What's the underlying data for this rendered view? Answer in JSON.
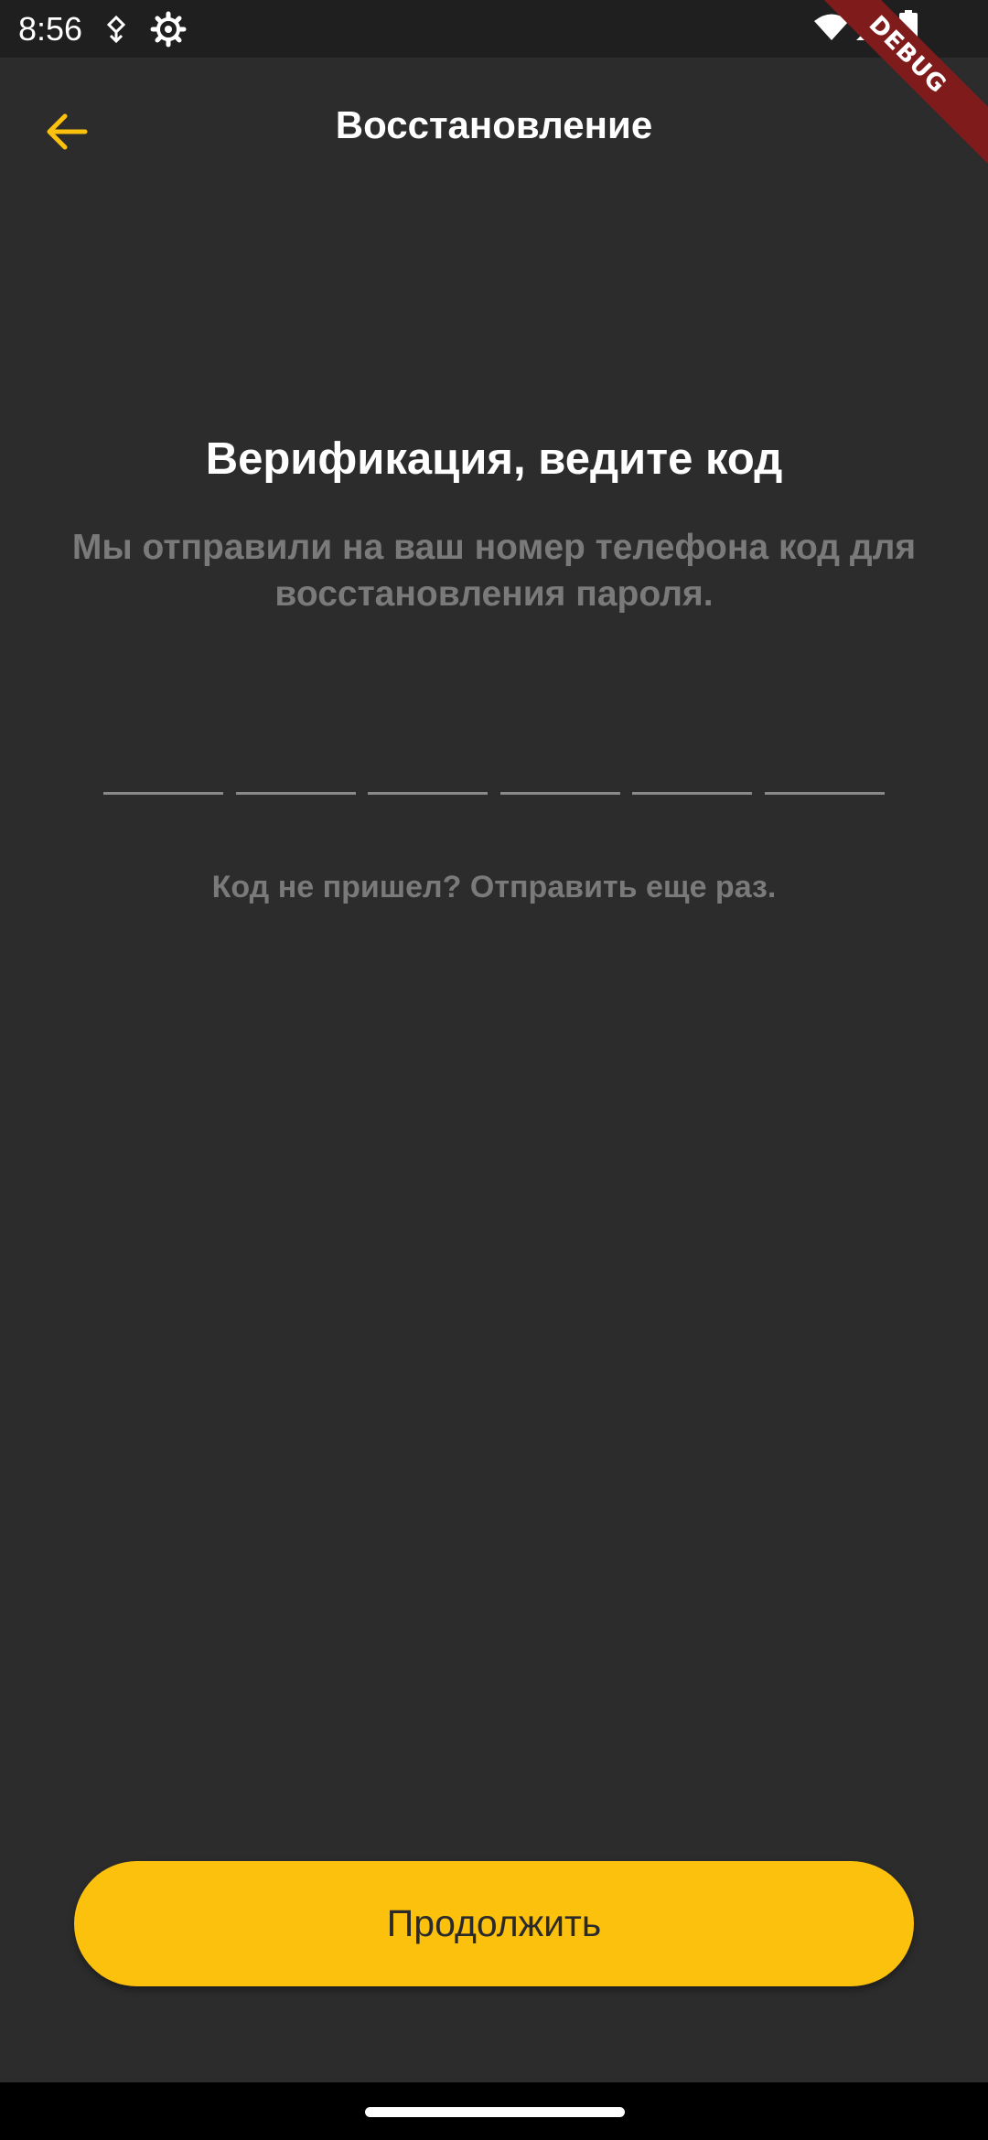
{
  "status_bar": {
    "time": "8:56",
    "icons": [
      "data-saver-icon",
      "settings-gear-icon",
      "wifi-icon",
      "cellular-signal-icon",
      "battery-icon"
    ]
  },
  "debug_banner": "DEBUG",
  "app_bar": {
    "title": "Восстановление",
    "back_icon": "arrow-left-icon"
  },
  "verification": {
    "heading": "Верификация, ведите код",
    "description": "Мы отправили на ваш номер телефона код для восстановления пароля.",
    "code_cells": [
      "",
      "",
      "",
      "",
      "",
      ""
    ],
    "resend": "Код не пришел? Отправить еще раз."
  },
  "continue_button": "Продолжить",
  "colors": {
    "background": "#2c2c2c",
    "status_bar": "#1f1f1f",
    "accent": "#fcc10c",
    "muted_text": "#7a7a7a",
    "debug_ribbon": "#7f1b1b"
  }
}
